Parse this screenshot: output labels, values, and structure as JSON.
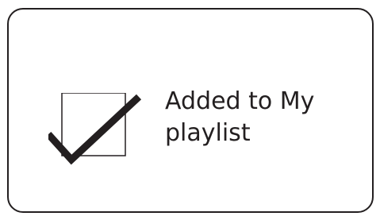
{
  "toast": {
    "message_line1": "Added to My",
    "message_line2": "playlist",
    "icon": "checkbox-checked-icon"
  },
  "colors": {
    "stroke": "#231f20",
    "background": "#ffffff"
  }
}
